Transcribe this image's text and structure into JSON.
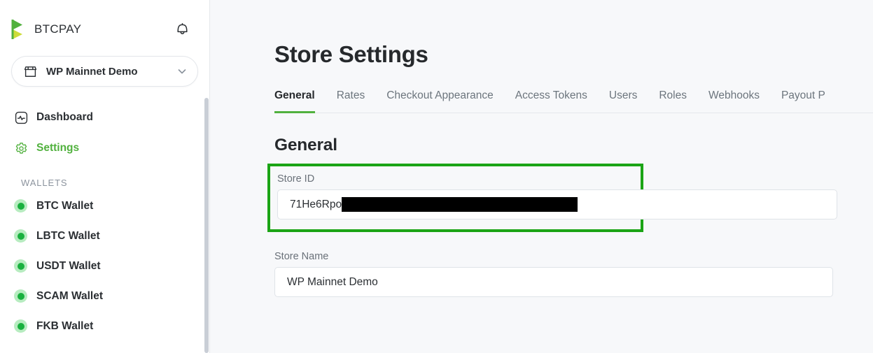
{
  "brand": {
    "name": "BTCPAY",
    "logo_icon": "btcpay-logo-icon",
    "bell_icon": "notification-bell-icon"
  },
  "store_selector": {
    "label": "WP Mainnet Demo",
    "shop_icon": "storefront-icon",
    "chevron_icon": "chevron-down-icon"
  },
  "sidebar": {
    "nav": [
      {
        "label": "Dashboard",
        "icon": "dashboard-pulse-icon",
        "active": false
      },
      {
        "label": "Settings",
        "icon": "gear-icon",
        "active": true
      }
    ],
    "section_title": "WALLETS",
    "wallets": [
      {
        "label": "BTC Wallet",
        "status": "online"
      },
      {
        "label": "LBTC Wallet",
        "status": "online"
      },
      {
        "label": "USDT Wallet",
        "status": "online"
      },
      {
        "label": "SCAM Wallet",
        "status": "online"
      },
      {
        "label": "FKB Wallet",
        "status": "online"
      }
    ]
  },
  "main": {
    "page_title": "Store Settings",
    "tabs": [
      {
        "label": "General",
        "active": true
      },
      {
        "label": "Rates",
        "active": false
      },
      {
        "label": "Checkout Appearance",
        "active": false
      },
      {
        "label": "Access Tokens",
        "active": false
      },
      {
        "label": "Users",
        "active": false
      },
      {
        "label": "Roles",
        "active": false
      },
      {
        "label": "Webhooks",
        "active": false
      },
      {
        "label": "Payout P",
        "active": false
      }
    ],
    "section_title": "General",
    "fields": {
      "store_id": {
        "label": "Store ID",
        "value_visible": "71He6Rpo",
        "redacted": true
      },
      "store_name": {
        "label": "Store Name",
        "value": "WP Mainnet Demo"
      }
    }
  },
  "colors": {
    "accent_green": "#51b13e",
    "annotation_green": "#1ba415",
    "logo_green": "#51b13e",
    "logo_lime": "#cddc39",
    "sidebar_bg": "#ffffff",
    "main_bg": "#f7f8fa",
    "redaction": "#000000"
  }
}
